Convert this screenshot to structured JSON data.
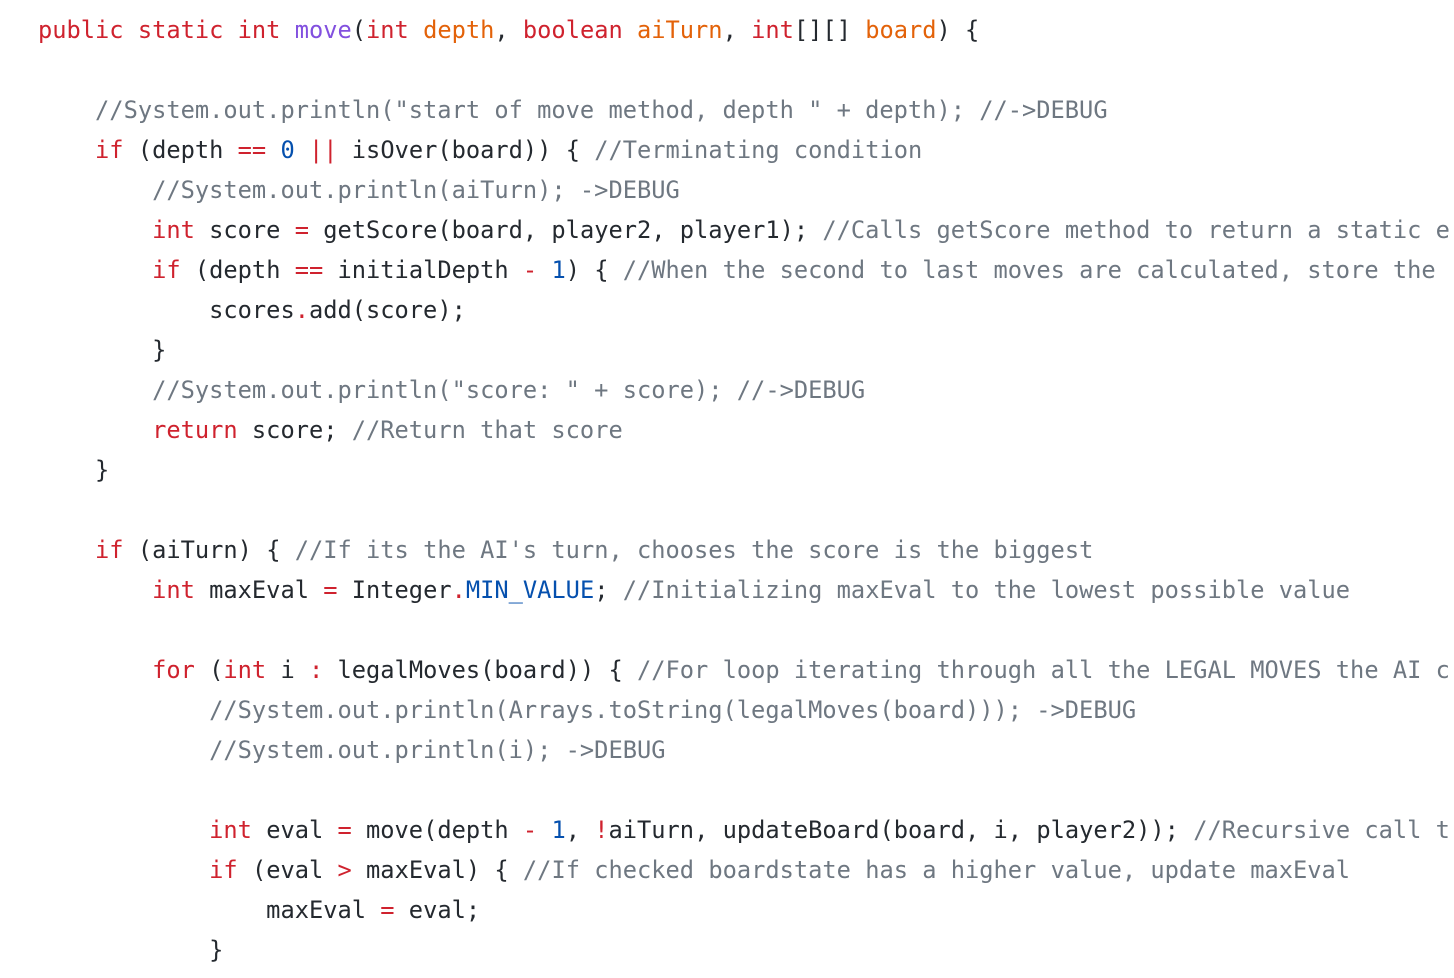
{
  "code": {
    "lines": [
      "public static int move(int depth, boolean aiTurn, int[][] board) {",
      "",
      "    //System.out.println(\"start of move method, depth \" + depth); //->DEBUG",
      "    if (depth == 0 || isOver(board)) { //Terminating condition",
      "        //System.out.println(aiTurn); ->DEBUG",
      "        int score = getScore(board, player2, player1); //Calls getScore method to return a static e",
      "        if (depth == initialDepth - 1) { //When the second to last moves are calculated, store the",
      "            scores.add(score);",
      "        }",
      "        //System.out.println(\"score: \" + score); //->DEBUG",
      "        return score; //Return that score",
      "    }",
      "",
      "    if (aiTurn) { //If its the AI's turn, chooses the score is the biggest",
      "        int maxEval = Integer.MIN_VALUE; //Initializing maxEval to the lowest possible value",
      "",
      "        for (int i : legalMoves(board)) { //For loop iterating through all the LEGAL MOVES the AI c",
      "            //System.out.println(Arrays.toString(legalMoves(board))); ->DEBUG",
      "            //System.out.println(i); ->DEBUG",
      "",
      "            int eval = move(depth - 1, !aiTurn, updateBoard(board, i, player2)); //Recursive call t",
      "            if (eval > maxEval) { //If checked boardstate has a higher value, update maxEval",
      "                maxEval = eval;",
      "            }"
    ]
  },
  "colors": {
    "keyword": "#cf222e",
    "function": "#8250df",
    "parameter": "#e36209",
    "number_constant": "#0550ae",
    "comment": "#6e7781",
    "text": "#24292f",
    "background": "#ffffff"
  }
}
